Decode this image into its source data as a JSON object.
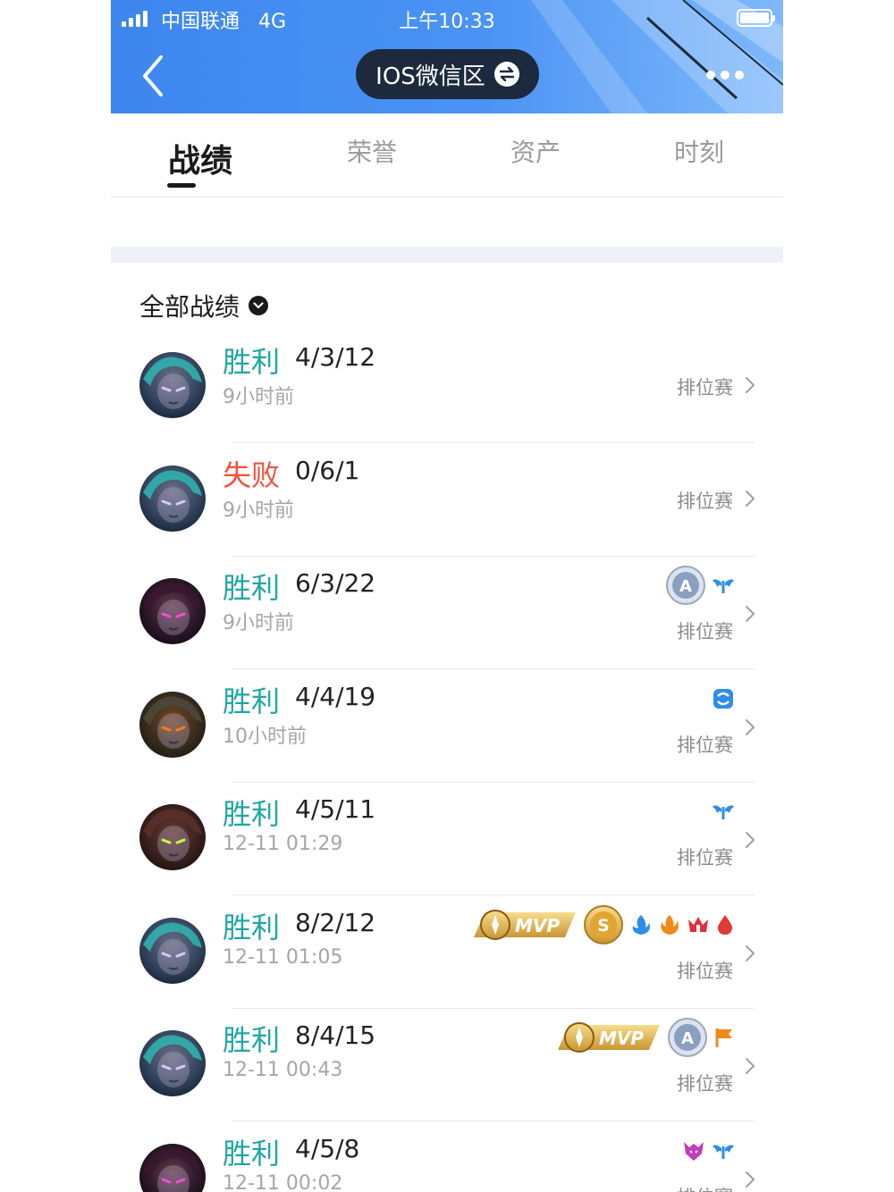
{
  "status_bar": {
    "carrier": "中国联通",
    "network": "4G",
    "time": "上午10:33"
  },
  "nav": {
    "region_label": "IOS微信区"
  },
  "tabs": [
    {
      "label": "战绩",
      "active": true
    },
    {
      "label": "荣誉",
      "active": false
    },
    {
      "label": "资产",
      "active": false
    },
    {
      "label": "时刻",
      "active": false
    }
  ],
  "section": {
    "title": "全部战绩"
  },
  "matches": [
    {
      "result": "胜利",
      "outcome": "win",
      "kda": "4/3/12",
      "time": "9小时前",
      "mode": "排位赛",
      "hero": "hero-teal",
      "badges": []
    },
    {
      "result": "失败",
      "outcome": "lose",
      "kda": "0/6/1",
      "time": "9小时前",
      "mode": "排位赛",
      "hero": "hero-teal",
      "badges": []
    },
    {
      "result": "胜利",
      "outcome": "win",
      "kda": "6/3/22",
      "time": "9小时前",
      "mode": "排位赛",
      "hero": "hero-purple",
      "badges": [
        "grade-a-icon",
        "wings-icon"
      ]
    },
    {
      "result": "胜利",
      "outcome": "win",
      "kda": "4/4/19",
      "time": "10小时前",
      "mode": "排位赛",
      "hero": "hero-orange",
      "badges": [
        "shield-icon"
      ]
    },
    {
      "result": "胜利",
      "outcome": "win",
      "kda": "4/5/11",
      "time": "12-11 01:29",
      "mode": "排位赛",
      "hero": "hero-brown",
      "badges": [
        "wings-icon"
      ]
    },
    {
      "result": "胜利",
      "outcome": "win",
      "kda": "8/2/12",
      "time": "12-11 01:05",
      "mode": "排位赛",
      "hero": "hero-teal",
      "badges": [
        "mvp-badge",
        "grade-s-icon",
        "blue-flame-icon",
        "orange-flame-icon",
        "red-crown-icon",
        "blood-drop-icon"
      ]
    },
    {
      "result": "胜利",
      "outcome": "win",
      "kda": "8/4/15",
      "time": "12-11 00:43",
      "mode": "排位赛",
      "hero": "hero-teal",
      "badges": [
        "mvp-badge",
        "grade-a-icon",
        "flag-icon"
      ]
    },
    {
      "result": "胜利",
      "outcome": "win",
      "kda": "4/5/8",
      "time": "12-11 00:02",
      "mode": "排位赛",
      "hero": "hero-purple",
      "badges": [
        "pink-demon-icon",
        "wings-icon"
      ]
    }
  ],
  "badge_labels": {
    "mvp": "MVP",
    "grade_a": "A",
    "grade_s": "S"
  }
}
